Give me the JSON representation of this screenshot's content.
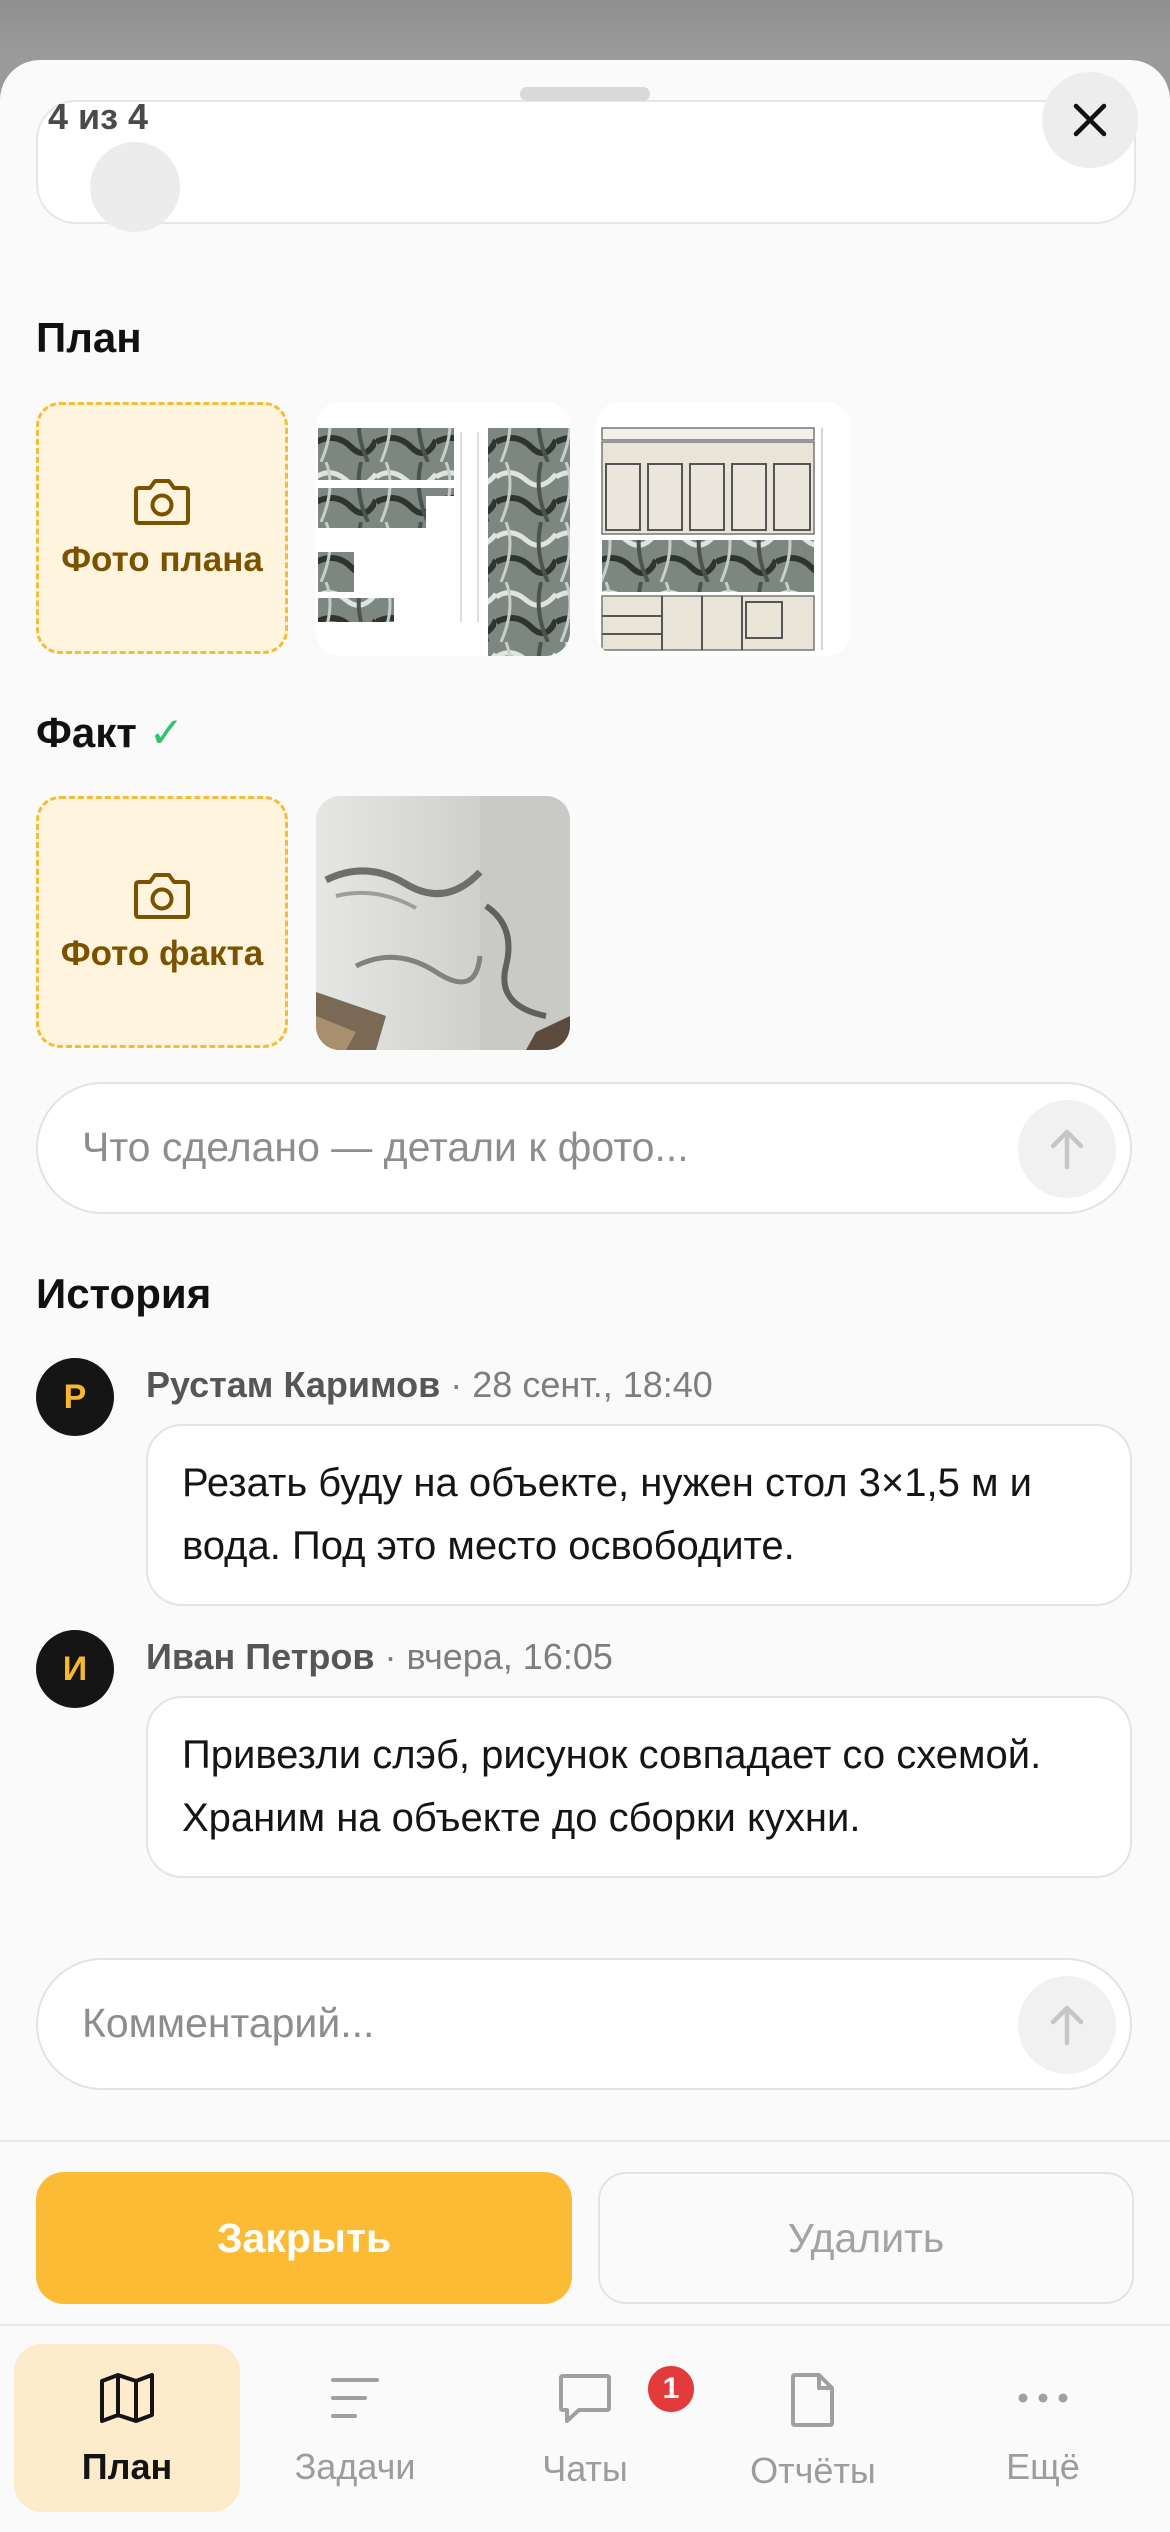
{
  "sheet": {
    "counter": "4 из 4"
  },
  "plan": {
    "title": "План",
    "add_label": "Фото плана"
  },
  "fact": {
    "title": "Факт",
    "check": "✓",
    "add_label": "Фото факта"
  },
  "fact_note": {
    "placeholder": "Что сделано — детали к фото..."
  },
  "history": {
    "title": "История",
    "comments": [
      {
        "initial": "Р",
        "author": "Рустам Каримов",
        "time": " · 28 сент., 18:40",
        "text": "Резать буду на объекте, нужен стол 3×1,5 м и вода. Под это место освободите."
      },
      {
        "initial": "И",
        "author": "Иван Петров",
        "time": " · вчера, 16:05",
        "text": "Привезли слэб, рисунок совпадает со схемой. Храним на объекте до сборки кухни."
      }
    ]
  },
  "comment_input": {
    "placeholder": "Комментарий..."
  },
  "actions": {
    "close_label": "Закрыть",
    "delete_label": "Удалить"
  },
  "tabs": [
    {
      "label": "План",
      "icon": "map-icon",
      "active": true
    },
    {
      "label": "Задачи",
      "icon": "tasks-icon"
    },
    {
      "label": "Чаты",
      "icon": "chat-icon",
      "badge": "1"
    },
    {
      "label": "Отчёты",
      "icon": "document-icon"
    },
    {
      "label": "Ещё",
      "icon": "more-icon"
    }
  ],
  "colors": {
    "accent": "#fbbb35",
    "badge": "#e33b3b",
    "check": "#2fc56a"
  }
}
